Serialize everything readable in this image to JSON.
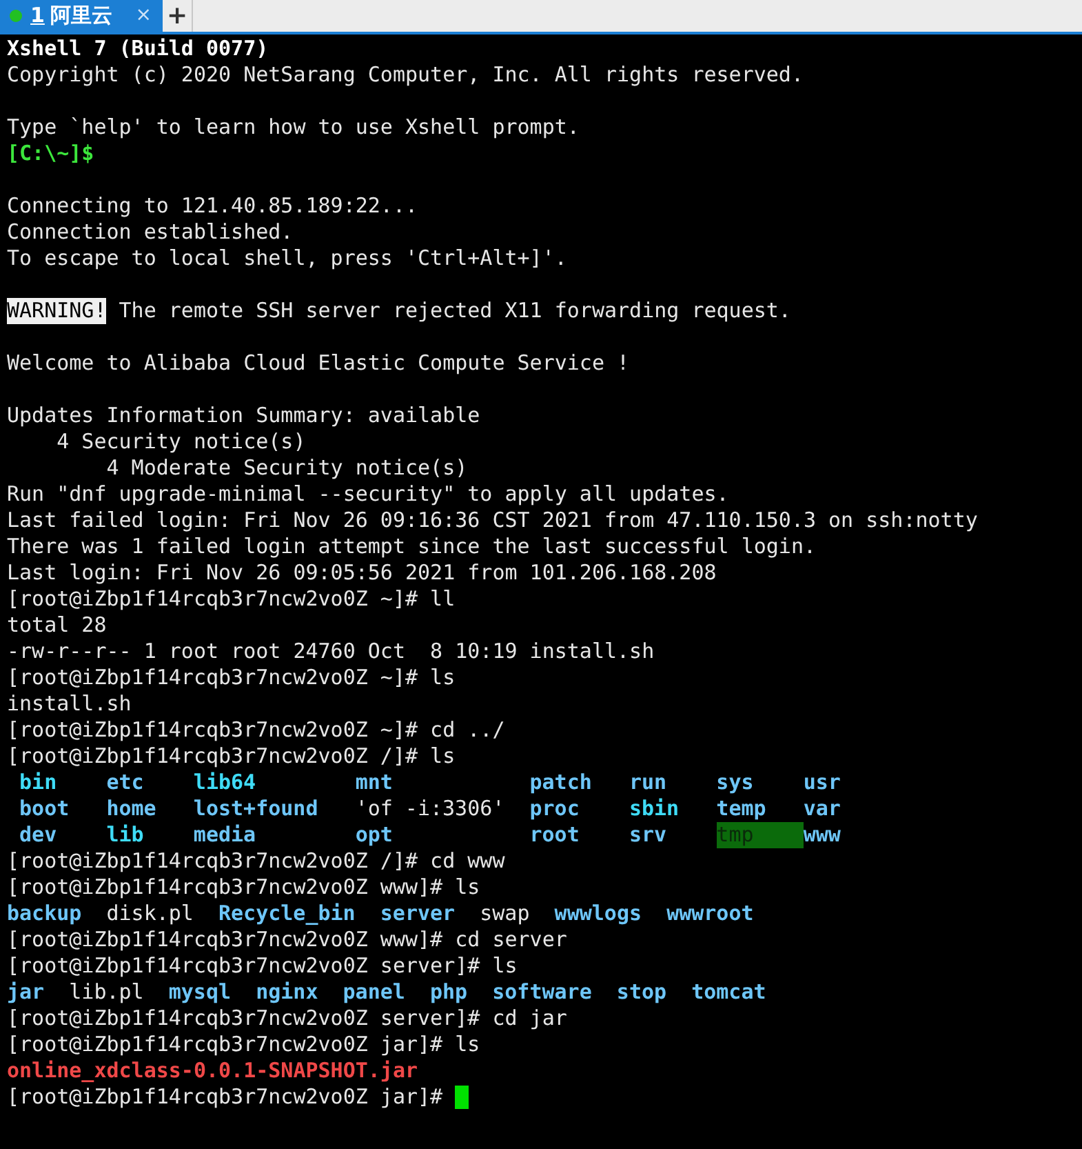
{
  "tabs": [
    {
      "number": "1",
      "label": "阿里云",
      "close": "×",
      "connected": true,
      "selected": true
    }
  ],
  "new_tab": "+",
  "terminal": {
    "lines": [
      {
        "kind": "text",
        "segments": [
          {
            "text": "Xshell 7 (Build 0077)",
            "kind": "bold"
          }
        ]
      },
      {
        "kind": "text",
        "segments": [
          {
            "text": "Copyright (c) 2020 NetSarang Computer, Inc. All rights reserved.",
            "kind": "plain"
          }
        ]
      },
      {
        "kind": "blank"
      },
      {
        "kind": "text",
        "segments": [
          {
            "text": "Type `help' to learn how to use Xshell prompt.",
            "kind": "plain"
          }
        ]
      },
      {
        "kind": "text",
        "segments": [
          {
            "text": "[C:\\~]$",
            "kind": "local_prompt"
          }
        ]
      },
      {
        "kind": "blank"
      },
      {
        "kind": "text",
        "segments": [
          {
            "text": "Connecting to 121.40.85.189:22...",
            "kind": "plain"
          }
        ]
      },
      {
        "kind": "text",
        "segments": [
          {
            "text": "Connection established.",
            "kind": "plain"
          }
        ]
      },
      {
        "kind": "text",
        "segments": [
          {
            "text": "To escape to local shell, press 'Ctrl+Alt+]'.",
            "kind": "plain"
          }
        ]
      },
      {
        "kind": "blank"
      },
      {
        "kind": "text",
        "segments": [
          {
            "text": "WARNING!",
            "kind": "warning"
          },
          {
            "text": " The remote SSH server rejected X11 forwarding request.",
            "kind": "plain"
          }
        ]
      },
      {
        "kind": "blank"
      },
      {
        "kind": "text",
        "segments": [
          {
            "text": "Welcome to Alibaba Cloud Elastic Compute Service !",
            "kind": "plain"
          }
        ]
      },
      {
        "kind": "blank"
      },
      {
        "kind": "text",
        "segments": [
          {
            "text": "Updates Information Summary: available",
            "kind": "plain"
          }
        ]
      },
      {
        "kind": "text",
        "segments": [
          {
            "text": "    4 Security notice(s)",
            "kind": "plain"
          }
        ]
      },
      {
        "kind": "text",
        "segments": [
          {
            "text": "        4 Moderate Security notice(s)",
            "kind": "plain"
          }
        ]
      },
      {
        "kind": "text",
        "segments": [
          {
            "text": "Run \"dnf upgrade-minimal --security\" to apply all updates.",
            "kind": "plain"
          }
        ]
      },
      {
        "kind": "text",
        "segments": [
          {
            "text": "Last failed login: Fri Nov 26 09:16:36 CST 2021 from 47.110.150.3 on ssh:notty",
            "kind": "plain"
          }
        ]
      },
      {
        "kind": "text",
        "segments": [
          {
            "text": "There was 1 failed login attempt since the last successful login.",
            "kind": "plain"
          }
        ]
      },
      {
        "kind": "text",
        "segments": [
          {
            "text": "Last login: Fri Nov 26 09:05:56 2021 from 101.206.168.208",
            "kind": "plain"
          }
        ]
      },
      {
        "kind": "text",
        "segments": [
          {
            "text": "[root@iZbp1f14rcqb3r7ncw2vo0Z ~]# ll",
            "kind": "plain"
          }
        ]
      },
      {
        "kind": "text",
        "segments": [
          {
            "text": "total 28",
            "kind": "plain"
          }
        ]
      },
      {
        "kind": "text",
        "segments": [
          {
            "text": "-rw-r--r-- 1 root root 24760 Oct  8 10:19 install.sh",
            "kind": "plain"
          }
        ]
      },
      {
        "kind": "text",
        "segments": [
          {
            "text": "[root@iZbp1f14rcqb3r7ncw2vo0Z ~]# ls",
            "kind": "plain"
          }
        ]
      },
      {
        "kind": "text",
        "segments": [
          {
            "text": "install.sh",
            "kind": "plain"
          }
        ]
      },
      {
        "kind": "text",
        "segments": [
          {
            "text": "[root@iZbp1f14rcqb3r7ncw2vo0Z ~]# cd ../",
            "kind": "plain"
          }
        ]
      },
      {
        "kind": "text",
        "segments": [
          {
            "text": "[root@iZbp1f14rcqb3r7ncw2vo0Z /]# ls",
            "kind": "plain"
          }
        ]
      },
      {
        "kind": "columns",
        "segments": [
          {
            "text": "bin",
            "kind": "link"
          },
          {
            "text": "etc",
            "kind": "dir"
          },
          {
            "text": "lib64",
            "kind": "link"
          },
          {
            "text": "mnt",
            "kind": "dir"
          },
          {
            "text": "patch",
            "kind": "dir"
          },
          {
            "text": "run",
            "kind": "dir"
          },
          {
            "text": "sys",
            "kind": "dir"
          },
          {
            "text": "usr",
            "kind": "dir"
          }
        ]
      },
      {
        "kind": "columns",
        "segments": [
          {
            "text": "boot",
            "kind": "dir"
          },
          {
            "text": "home",
            "kind": "dir"
          },
          {
            "text": "lost+found",
            "kind": "dir"
          },
          {
            "text": "'of -i:3306'",
            "kind": "quoted"
          },
          {
            "text": "proc",
            "kind": "dir"
          },
          {
            "text": "sbin",
            "kind": "link"
          },
          {
            "text": "temp",
            "kind": "dir"
          },
          {
            "text": "var",
            "kind": "dir"
          }
        ]
      },
      {
        "kind": "columns",
        "segments": [
          {
            "text": "dev",
            "kind": "dir"
          },
          {
            "text": "lib",
            "kind": "link"
          },
          {
            "text": "media",
            "kind": "dir"
          },
          {
            "text": "opt",
            "kind": "dir"
          },
          {
            "text": "root",
            "kind": "dir"
          },
          {
            "text": "srv",
            "kind": "dir"
          },
          {
            "text": "tmp",
            "kind": "sticky"
          },
          {
            "text": "www",
            "kind": "dir"
          }
        ]
      },
      {
        "kind": "text",
        "segments": [
          {
            "text": "[root@iZbp1f14rcqb3r7ncw2vo0Z /]# cd www",
            "kind": "plain"
          }
        ]
      },
      {
        "kind": "text",
        "segments": [
          {
            "text": "[root@iZbp1f14rcqb3r7ncw2vo0Z www]# ls",
            "kind": "plain"
          }
        ]
      },
      {
        "kind": "list",
        "segments": [
          {
            "text": "backup",
            "kind": "dir"
          },
          {
            "text": "disk.pl",
            "kind": "plain"
          },
          {
            "text": "Recycle_bin",
            "kind": "dir"
          },
          {
            "text": "server",
            "kind": "dir"
          },
          {
            "text": "swap",
            "kind": "plain"
          },
          {
            "text": "wwwlogs",
            "kind": "dir"
          },
          {
            "text": "wwwroot",
            "kind": "dir"
          }
        ]
      },
      {
        "kind": "text",
        "segments": [
          {
            "text": "[root@iZbp1f14rcqb3r7ncw2vo0Z www]# cd server",
            "kind": "plain"
          }
        ]
      },
      {
        "kind": "text",
        "segments": [
          {
            "text": "[root@iZbp1f14rcqb3r7ncw2vo0Z server]# ls",
            "kind": "plain"
          }
        ]
      },
      {
        "kind": "list",
        "segments": [
          {
            "text": "jar",
            "kind": "dir"
          },
          {
            "text": "lib.pl",
            "kind": "plain"
          },
          {
            "text": "mysql",
            "kind": "dir"
          },
          {
            "text": "nginx",
            "kind": "dir"
          },
          {
            "text": "panel",
            "kind": "dir"
          },
          {
            "text": "php",
            "kind": "dir"
          },
          {
            "text": "software",
            "kind": "dir"
          },
          {
            "text": "stop",
            "kind": "dir"
          },
          {
            "text": "tomcat",
            "kind": "dir"
          }
        ]
      },
      {
        "kind": "text",
        "segments": [
          {
            "text": "[root@iZbp1f14rcqb3r7ncw2vo0Z server]# cd jar",
            "kind": "plain"
          }
        ]
      },
      {
        "kind": "text",
        "segments": [
          {
            "text": "[root@iZbp1f14rcqb3r7ncw2vo0Z jar]# ls",
            "kind": "plain"
          }
        ]
      },
      {
        "kind": "text",
        "segments": [
          {
            "text": "online_xdclass-0.0.1-SNAPSHOT.jar",
            "kind": "archive"
          }
        ]
      },
      {
        "kind": "text",
        "segments": [
          {
            "text": "[root@iZbp1f14rcqb3r7ncw2vo0Z jar]#",
            "kind": "plain"
          }
        ],
        "cursor": true
      }
    ]
  }
}
